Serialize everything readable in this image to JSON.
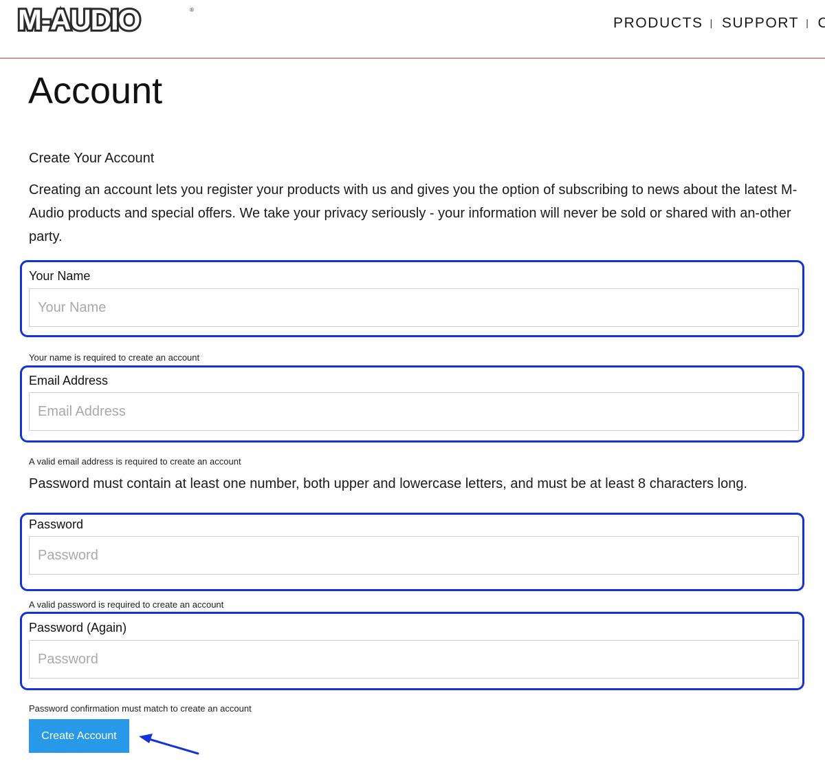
{
  "header": {
    "logo_text": "M-AUDIO",
    "logo_registered": "®",
    "nav": [
      {
        "label": "PRODUCTS"
      },
      {
        "label": "SUPPORT"
      },
      {
        "label": "CO"
      }
    ],
    "nav_separator": "|",
    "accent_color": "#d53a2c"
  },
  "page": {
    "title": "Account",
    "subtitle": "Create Your Account",
    "intro": "Creating an account lets you register your products with us and gives you the option of subscribing to news about the latest M-Audio products and special offers. We take your privacy seriously - your information will never be sold or shared with an-other party."
  },
  "form": {
    "name": {
      "label": "Your Name",
      "placeholder": "Your Name",
      "value": "",
      "help": "Your name is required to create an account"
    },
    "email": {
      "label": "Email Address",
      "placeholder": "Email Address",
      "value": "",
      "help": "A valid email address is required to create an account"
    },
    "password_rule": "Password must contain at least one number, both upper and lowercase letters, and must be at least 8 characters long.",
    "password": {
      "label": "Password",
      "placeholder": "Password",
      "value": "",
      "help": "A valid password is required to create an account"
    },
    "password_again": {
      "label": "Password (Again)",
      "placeholder": "Password",
      "value": "",
      "help": "Password confirmation must match to create an account"
    },
    "submit_label": "Create Account",
    "submit_color": "#2799e6",
    "highlight_color": "#1433d6"
  }
}
